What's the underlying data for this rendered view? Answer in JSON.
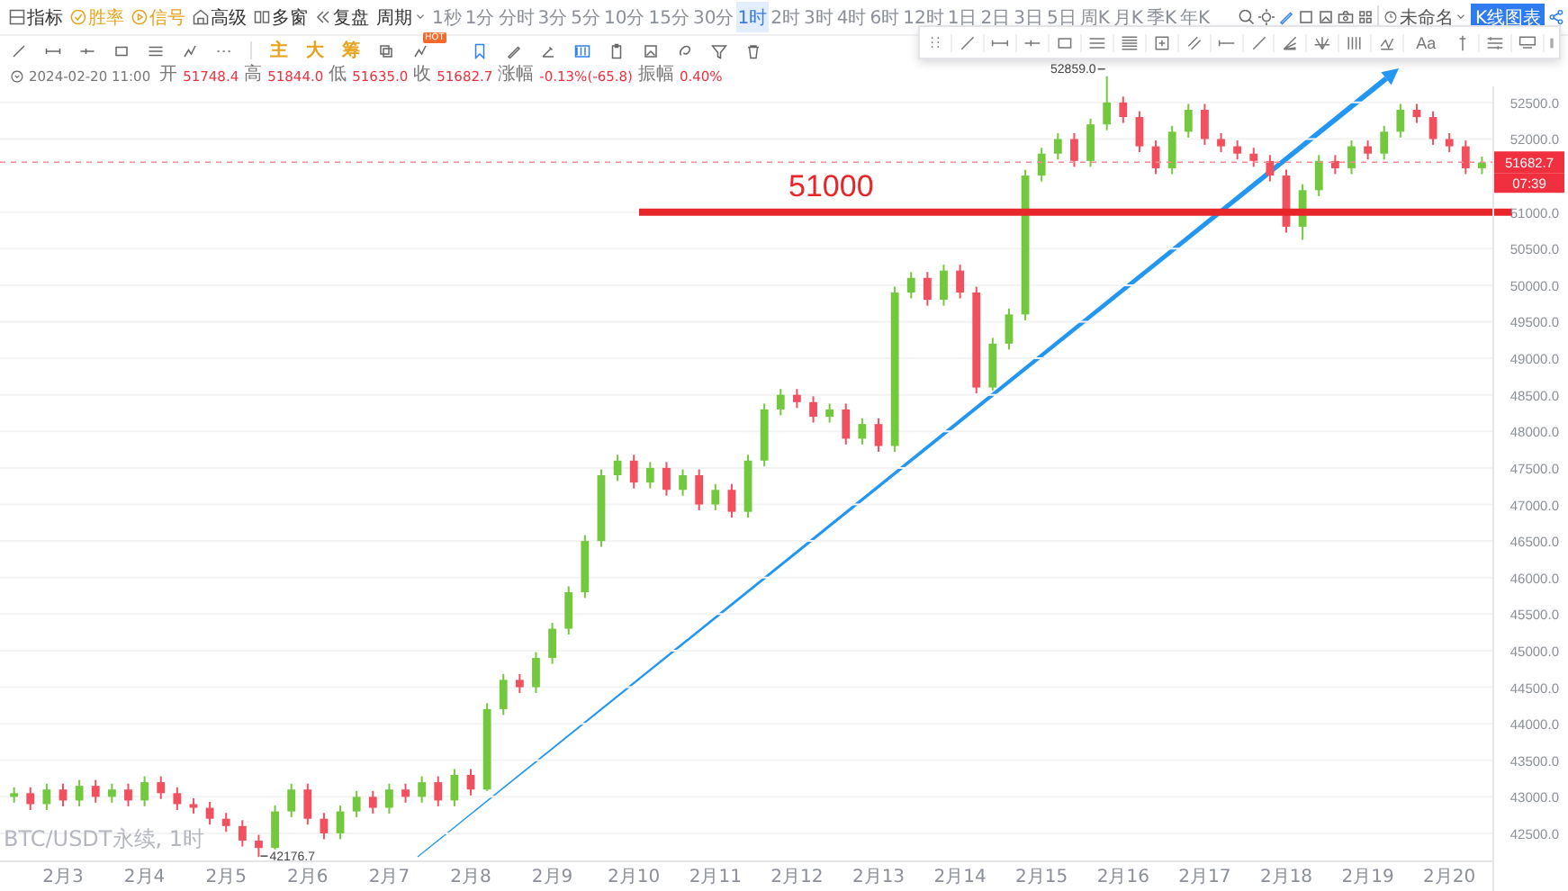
{
  "toolbar": {
    "tools": [
      {
        "label": "指标",
        "kind": "plain"
      },
      {
        "label": "胜率",
        "kind": "accent"
      },
      {
        "label": "信号",
        "kind": "accent"
      },
      {
        "label": "高级",
        "kind": "plain"
      },
      {
        "label": "多窗",
        "kind": "plain"
      },
      {
        "label": "复盘",
        "kind": "plain"
      },
      {
        "label": "周期",
        "kind": "dropdown"
      }
    ],
    "periods": [
      {
        "label": "1秒",
        "selected": false
      },
      {
        "label": "1分",
        "selected": false
      },
      {
        "label": "分时",
        "selected": false
      },
      {
        "label": "3分",
        "selected": false
      },
      {
        "label": "5分",
        "selected": false
      },
      {
        "label": "10分",
        "selected": false
      },
      {
        "label": "15分",
        "selected": false
      },
      {
        "label": "30分",
        "selected": false
      },
      {
        "label": "1时",
        "selected": true
      },
      {
        "label": "2时",
        "selected": false
      },
      {
        "label": "3时",
        "selected": false
      },
      {
        "label": "4时",
        "selected": false
      },
      {
        "label": "6时",
        "selected": false
      },
      {
        "label": "12时",
        "selected": false
      },
      {
        "label": "1日",
        "selected": false
      },
      {
        "label": "2日",
        "selected": false
      },
      {
        "label": "3日",
        "selected": false
      },
      {
        "label": "5日",
        "selected": false
      },
      {
        "label": "周K",
        "selected": false
      },
      {
        "label": "月K",
        "selected": false
      },
      {
        "label": "季K",
        "selected": false
      },
      {
        "label": "年K",
        "selected": false
      }
    ],
    "layout_name": "未命名",
    "chart_button": "K线图表"
  },
  "draw_bar": {
    "overlays": [
      "主",
      "大",
      "筹"
    ],
    "badge": "HOT"
  },
  "info": {
    "time": "2024-02-20 11:00",
    "fields": [
      {
        "label": "开",
        "value": "51748.4"
      },
      {
        "label": "高",
        "value": "51844.0"
      },
      {
        "label": "低",
        "value": "51635.0"
      },
      {
        "label": "收",
        "value": "51682.7"
      },
      {
        "label": "涨幅",
        "value": "-0.13%(-65.8)"
      },
      {
        "label": "振幅",
        "value": "0.40%"
      }
    ]
  },
  "floating_toolbar": {
    "text_tool": "Aa"
  },
  "chart": {
    "watermark": "BTC/USDT永续, 1时",
    "countdown": "07:39",
    "chart_data": {
      "type": "candlestick",
      "grid": true,
      "categories": [
        null,
        null,
        null,
        "2月3",
        null,
        null,
        null,
        null,
        "2月4",
        null,
        null,
        null,
        null,
        "2月5",
        null,
        null,
        null,
        null,
        "2月6",
        null,
        null,
        null,
        null,
        "2月7",
        null,
        null,
        null,
        null,
        "2月8",
        null,
        null,
        null,
        null,
        "2月9",
        null,
        null,
        null,
        null,
        "2月10",
        null,
        null,
        null,
        null,
        "2月11",
        null,
        null,
        null,
        null,
        "2月12",
        null,
        null,
        null,
        null,
        "2月13",
        null,
        null,
        null,
        null,
        "2月14",
        null,
        null,
        null,
        null,
        "2月15",
        null,
        null,
        null,
        null,
        "2月16",
        null,
        null,
        null,
        null,
        "2月17",
        null,
        null,
        null,
        null,
        "2月18",
        null,
        null,
        null,
        null,
        "2月19",
        null,
        null,
        null,
        null,
        "2月20",
        null,
        null
      ],
      "ohlc": [
        [
          43000,
          43130,
          42920,
          43050
        ],
        [
          43050,
          43130,
          42820,
          42900
        ],
        [
          42900,
          43180,
          42820,
          43100
        ],
        [
          43100,
          43180,
          42870,
          42950
        ],
        [
          42950,
          43230,
          42870,
          43150
        ],
        [
          43150,
          43230,
          42920,
          43000
        ],
        [
          43000,
          43180,
          42920,
          43100
        ],
        [
          43100,
          43180,
          42870,
          42950
        ],
        [
          42950,
          43280,
          42870,
          43200
        ],
        [
          43200,
          43280,
          42970,
          43050
        ],
        [
          43050,
          43130,
          42820,
          42900
        ],
        [
          42900,
          42980,
          42770,
          42850
        ],
        [
          42850,
          42930,
          42620,
          42700
        ],
        [
          42700,
          42780,
          42520,
          42600
        ],
        [
          42600,
          42680,
          42320,
          42400
        ],
        [
          42400,
          42480,
          42176.7,
          42300
        ],
        [
          42300,
          42880,
          42280,
          42800
        ],
        [
          42800,
          43180,
          42720,
          43100
        ],
        [
          43100,
          43180,
          42620,
          42700
        ],
        [
          42700,
          42780,
          42420,
          42500
        ],
        [
          42500,
          42880,
          42420,
          42800
        ],
        [
          42800,
          43080,
          42720,
          43000
        ],
        [
          43000,
          43080,
          42770,
          42850
        ],
        [
          42850,
          43180,
          42770,
          43100
        ],
        [
          43100,
          43180,
          42920,
          43000
        ],
        [
          43000,
          43280,
          42920,
          43200
        ],
        [
          43200,
          43280,
          42870,
          42950
        ],
        [
          42950,
          43380,
          42870,
          43300
        ],
        [
          43300,
          43380,
          43020,
          43100
        ],
        [
          43100,
          44280,
          43080,
          44200
        ],
        [
          44200,
          44680,
          44120,
          44600
        ],
        [
          44600,
          44680,
          44420,
          44500
        ],
        [
          44500,
          44980,
          44420,
          44900
        ],
        [
          44900,
          45380,
          44820,
          45300
        ],
        [
          45300,
          45880,
          45220,
          45800
        ],
        [
          45800,
          46580,
          45720,
          46500
        ],
        [
          46500,
          47480,
          46420,
          47400
        ],
        [
          47400,
          47680,
          47320,
          47600
        ],
        [
          47600,
          47680,
          47220,
          47300
        ],
        [
          47300,
          47580,
          47220,
          47500
        ],
        [
          47500,
          47580,
          47120,
          47200
        ],
        [
          47200,
          47480,
          47120,
          47400
        ],
        [
          47400,
          47480,
          46920,
          47000
        ],
        [
          47000,
          47280,
          46920,
          47200
        ],
        [
          47200,
          47280,
          46820,
          46900
        ],
        [
          46900,
          47680,
          46820,
          47600
        ],
        [
          47600,
          48380,
          47520,
          48300
        ],
        [
          48300,
          48580,
          48220,
          48500
        ],
        [
          48500,
          48580,
          48320,
          48400
        ],
        [
          48400,
          48480,
          48120,
          48200
        ],
        [
          48200,
          48380,
          48120,
          48300
        ],
        [
          48300,
          48380,
          47820,
          47900
        ],
        [
          47900,
          48180,
          47820,
          48100
        ],
        [
          48100,
          48180,
          47720,
          47800
        ],
        [
          47800,
          49980,
          47720,
          49900
        ],
        [
          49900,
          50180,
          49820,
          50100
        ],
        [
          50100,
          50180,
          49720,
          49800
        ],
        [
          49800,
          50280,
          49720,
          50200
        ],
        [
          50200,
          50280,
          49820,
          49900
        ],
        [
          49900,
          49980,
          48520,
          48600
        ],
        [
          48600,
          49280,
          48560,
          49200
        ],
        [
          49200,
          49680,
          49120,
          49600
        ],
        [
          49600,
          51580,
          49520,
          51500
        ],
        [
          51500,
          51880,
          51420,
          51800
        ],
        [
          51800,
          52080,
          51720,
          52000
        ],
        [
          52000,
          52080,
          51620,
          51700
        ],
        [
          51700,
          52280,
          51620,
          52200
        ],
        [
          52200,
          52859,
          52120,
          52500
        ],
        [
          52500,
          52580,
          52220,
          52300
        ],
        [
          52300,
          52380,
          51820,
          51900
        ],
        [
          51900,
          51980,
          51520,
          51600
        ],
        [
          51600,
          52180,
          51520,
          52100
        ],
        [
          52100,
          52480,
          52020,
          52400
        ],
        [
          52400,
          52480,
          51920,
          52000
        ],
        [
          52000,
          52080,
          51820,
          51900
        ],
        [
          51900,
          51980,
          51720,
          51800
        ],
        [
          51800,
          51880,
          51620,
          51700
        ],
        [
          51700,
          51780,
          51420,
          51500
        ],
        [
          51500,
          51580,
          50720,
          50800
        ],
        [
          50800,
          51380,
          50620,
          51300
        ],
        [
          51300,
          51780,
          51220,
          51700
        ],
        [
          51700,
          51780,
          51520,
          51600
        ],
        [
          51600,
          51980,
          51520,
          51900
        ],
        [
          51900,
          51980,
          51720,
          51800
        ],
        [
          51800,
          52180,
          51720,
          52100
        ],
        [
          52100,
          52480,
          52020,
          52400
        ],
        [
          52400,
          52480,
          52220,
          52300
        ],
        [
          52300,
          52380,
          51920,
          52000
        ],
        [
          52000,
          52080,
          51820,
          51900
        ],
        [
          51900,
          51980,
          51520,
          51600
        ],
        [
          51600,
          51760,
          51520,
          51680
        ]
      ],
      "ylim": [
        42130,
        52720
      ],
      "yticks": [
        {
          "value": 52500,
          "label": "52500.0"
        },
        {
          "value": 52000,
          "label": "52000.0"
        },
        {
          "value": 51000,
          "label": "51000.0"
        },
        {
          "value": 50500,
          "label": "50500.0"
        },
        {
          "value": 50000,
          "label": "50000.0"
        },
        {
          "value": 49500,
          "label": "49500.0"
        },
        {
          "value": 49000,
          "label": "49000.0"
        },
        {
          "value": 48500,
          "label": "48500.0"
        },
        {
          "value": 48000,
          "label": "48000.0"
        },
        {
          "value": 47500,
          "label": "47500.0"
        },
        {
          "value": 47000,
          "label": "47000.0"
        },
        {
          "value": 46500,
          "label": "46500.0"
        },
        {
          "value": 46000,
          "label": "46000.0"
        },
        {
          "value": 45500,
          "label": "45500.0"
        },
        {
          "value": 45000,
          "label": "45000.0"
        },
        {
          "value": 44500,
          "label": "44500.0"
        },
        {
          "value": 44000,
          "label": "44000.0"
        },
        {
          "value": 43500,
          "label": "43500.0"
        },
        {
          "value": 43000,
          "label": "43000.0"
        },
        {
          "value": 42500,
          "label": "42500.0"
        }
      ],
      "ref_lines": [
        {
          "axis": "y",
          "value": 51000,
          "label": "51000",
          "color": "#e8262a"
        },
        {
          "axis": "y",
          "value": 51682.7,
          "label": "51682.7",
          "color": "#f58a93"
        }
      ],
      "annotations": [
        "52859.0",
        "42176.7"
      ]
    }
  }
}
